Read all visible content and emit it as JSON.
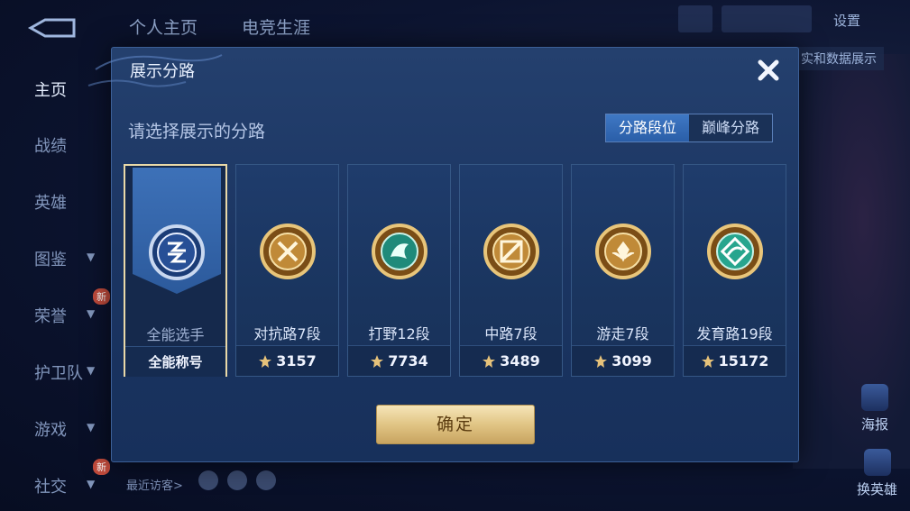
{
  "top_nav": {
    "tabs": [
      "个人主页",
      "电竞生涯"
    ],
    "settings_label": "设置",
    "notice_text": "实和数据展示"
  },
  "side_nav": {
    "items": [
      "主页",
      "战绩",
      "英雄",
      "图鉴",
      "荣誉",
      "护卫队",
      "游戏",
      "社交"
    ],
    "new_badge": "新"
  },
  "recent_visitors_label": "最近访客>",
  "right_actions": {
    "poster": "海报",
    "change_hero": "换英雄"
  },
  "modal": {
    "title": "展示分路",
    "prompt": "请选择展示的分路",
    "segments": [
      "分路段位",
      "巅峰分路"
    ],
    "active_segment": 0,
    "cards": [
      {
        "name": "全能选手",
        "sub": "全能称号",
        "score": "",
        "icon": "all-round-emblem-icon",
        "selected": true
      },
      {
        "name": "对抗路7段",
        "sub": "",
        "score": "3157",
        "icon": "clash-lane-emblem-icon",
        "selected": false
      },
      {
        "name": "打野12段",
        "sub": "",
        "score": "7734",
        "icon": "jungle-emblem-icon",
        "selected": false
      },
      {
        "name": "中路7段",
        "sub": "",
        "score": "3489",
        "icon": "mid-lane-emblem-icon",
        "selected": false
      },
      {
        "name": "游走7段",
        "sub": "",
        "score": "3099",
        "icon": "roam-emblem-icon",
        "selected": false
      },
      {
        "name": "发育路19段",
        "sub": "",
        "score": "15172",
        "icon": "farm-lane-emblem-icon",
        "selected": false
      }
    ],
    "confirm_label": "确定"
  },
  "colors": {
    "accent_blue": "#2a5ea8",
    "gold": "#e1c585",
    "modal_bg": "#1b3562"
  }
}
